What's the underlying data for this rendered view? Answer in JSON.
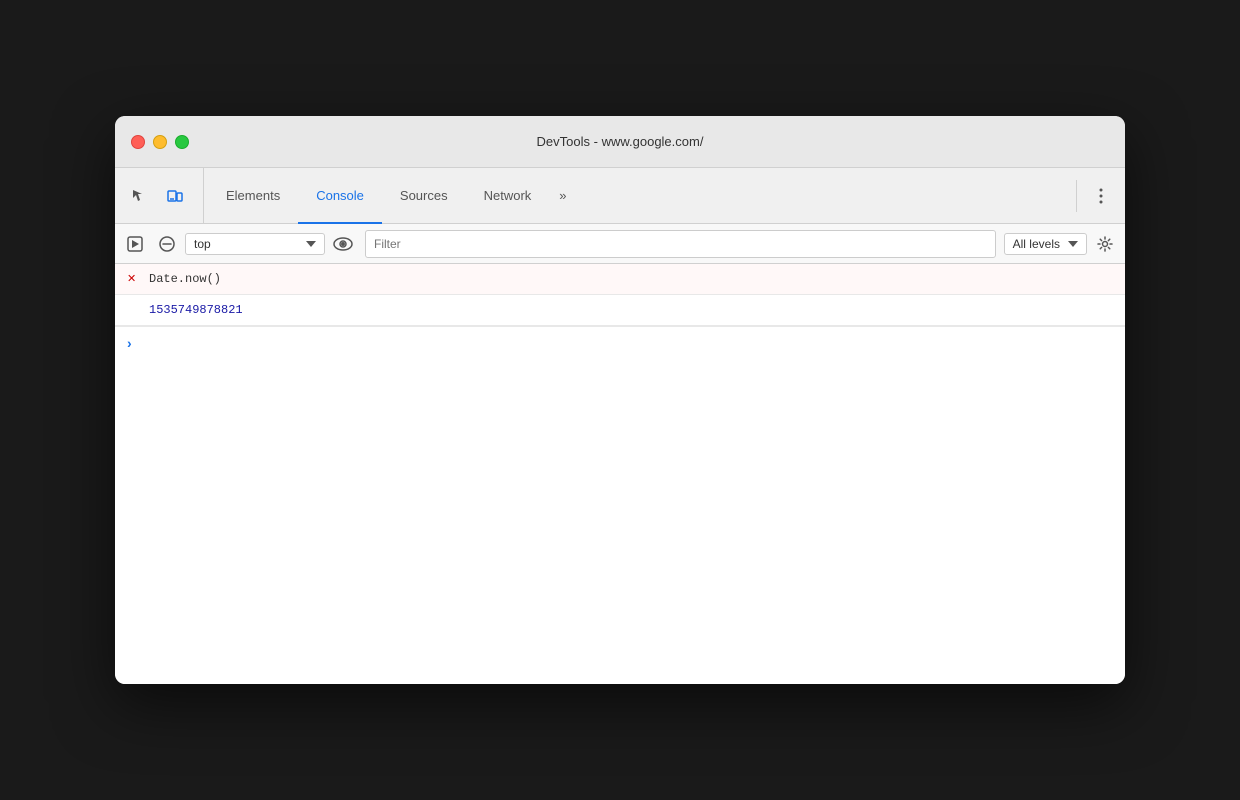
{
  "window": {
    "title": "DevTools - www.google.com/"
  },
  "tabs": {
    "items": [
      {
        "id": "elements",
        "label": "Elements",
        "active": false
      },
      {
        "id": "console",
        "label": "Console",
        "active": true
      },
      {
        "id": "sources",
        "label": "Sources",
        "active": false
      },
      {
        "id": "network",
        "label": "Network",
        "active": false
      },
      {
        "id": "more",
        "label": "»",
        "active": false
      }
    ]
  },
  "toolbar": {
    "context_select": "top",
    "filter_placeholder": "Filter",
    "levels_label": "All levels"
  },
  "console": {
    "entry": {
      "command": "Date.now()",
      "result": "1535749878821"
    },
    "input_placeholder": ""
  }
}
